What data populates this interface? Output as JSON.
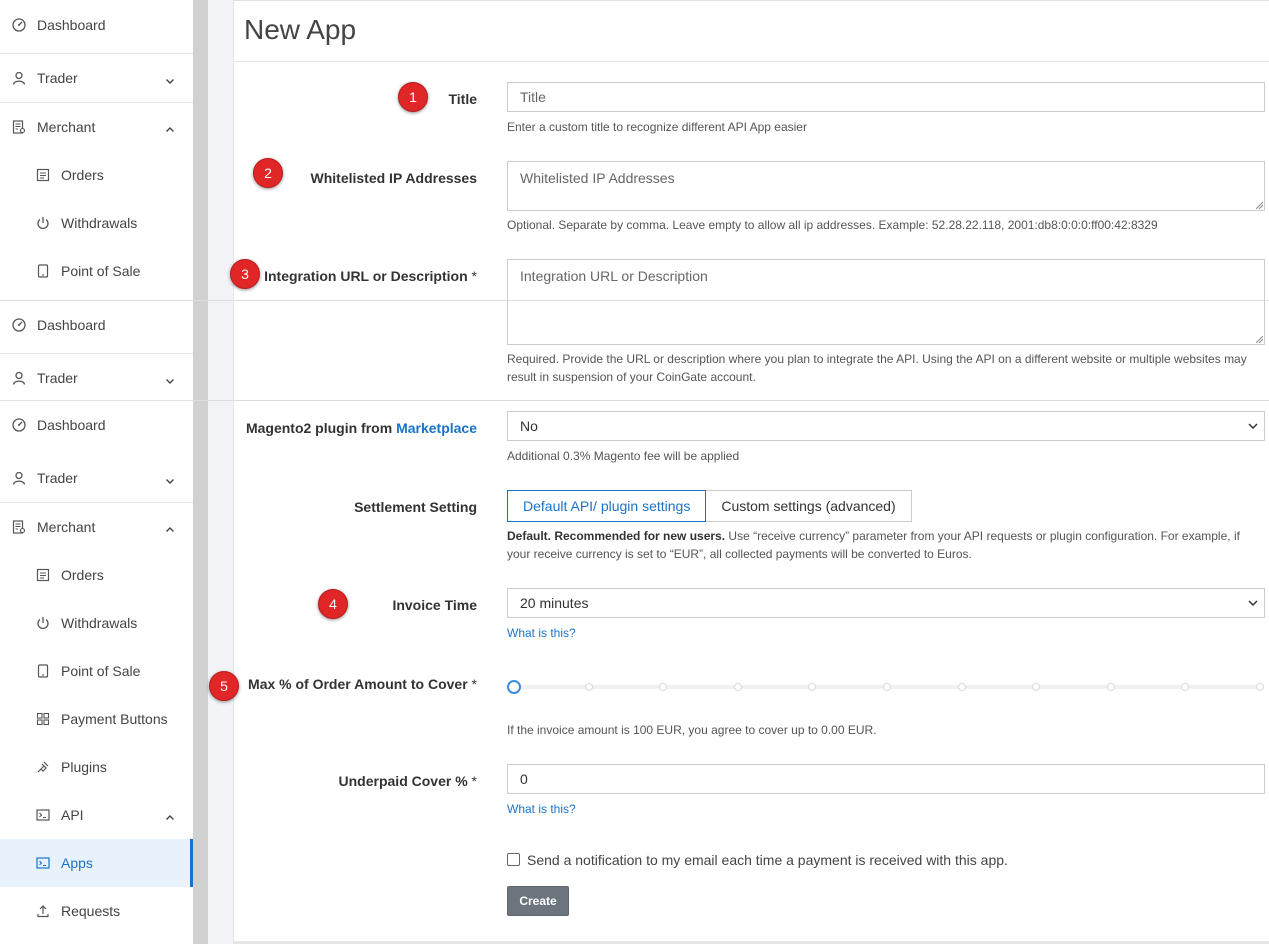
{
  "sidebar": {
    "items": [
      {
        "label": "Dashboard",
        "icon": "dashboard-icon"
      },
      {
        "label": "Trader",
        "icon": "user-icon",
        "chevron": "down"
      },
      {
        "label": "Merchant",
        "icon": "merchant-icon",
        "chevron": "up"
      },
      {
        "label": "Orders",
        "icon": "orders-icon"
      },
      {
        "label": "Withdrawals",
        "icon": "power-icon"
      },
      {
        "label": "Point of Sale",
        "icon": "tablet-icon"
      },
      {
        "label": "Dashboard",
        "icon": "dashboard-icon"
      },
      {
        "label": "Trader",
        "icon": "user-icon",
        "chevron": "down"
      },
      {
        "label": "Dashboard",
        "icon": "dashboard-icon"
      },
      {
        "label": "Trader",
        "icon": "user-icon",
        "chevron": "down"
      },
      {
        "label": "Merchant",
        "icon": "merchant-icon",
        "chevron": "up"
      },
      {
        "label": "Orders",
        "icon": "orders-icon"
      },
      {
        "label": "Withdrawals",
        "icon": "power-icon"
      },
      {
        "label": "Point of Sale",
        "icon": "tablet-icon"
      },
      {
        "label": "Payment Buttons",
        "icon": "grid-icon"
      },
      {
        "label": "Plugins",
        "icon": "plug-icon"
      },
      {
        "label": "API",
        "icon": "terminal-icon",
        "chevron": "up"
      },
      {
        "label": "Apps",
        "icon": "terminal-icon",
        "active": true
      },
      {
        "label": "Requests",
        "icon": "upload-icon"
      }
    ]
  },
  "page": {
    "title": "New App"
  },
  "form": {
    "title_label": "Title",
    "title_placeholder": "Title",
    "title_help": "Enter a custom title to recognize different API App easier",
    "ip_label": "Whitelisted IP Addresses",
    "ip_placeholder": "Whitelisted IP Addresses",
    "ip_help": "Optional. Separate by comma. Leave empty to allow all ip addresses. Example: 52.28.22.118, 2001:db8:0:0:0:ff00:42:8329",
    "url_label": "Integration URL or Description",
    "required_mark": "*",
    "url_placeholder": "Integration URL or Description",
    "url_help": "Required. Provide the URL or description where you plan to integrate the API. Using the API on a different website or multiple websites may result in suspension of your CoinGate account.",
    "magento_label": "Magento2 plugin from",
    "magento_link": "Marketplace",
    "magento_value": "No",
    "magento_help": "Additional 0.3% Magento fee will be applied",
    "settlement_label": "Settlement Setting",
    "settlement_options": [
      "Default API/ plugin settings",
      "Custom settings (advanced)"
    ],
    "settlement_help_bold": "Default. Recommended for new users.",
    "settlement_help": " Use “receive currency” parameter from your API requests or plugin configuration. For example, if your receive currency is set to “EUR”, all collected payments will be converted to Euros.",
    "invoice_label": "Invoice Time",
    "invoice_value": "20 minutes",
    "what_is_this": "What is this?",
    "maxcover_label": "Max % of Order Amount to Cover",
    "maxcover_value_fraction": 0,
    "maxcover_help": "If the invoice amount is 100 EUR, you agree to cover up to 0.00 EUR.",
    "underpaid_label": "Underpaid Cover %",
    "underpaid_value": "0",
    "notify_label": "Send a notification to my email each time a payment is received with this app.",
    "notify_checked": false,
    "create_label": "Create"
  },
  "annotations": [
    "1",
    "2",
    "3",
    "4",
    "5"
  ],
  "colors": {
    "accent": "#1a73c9",
    "badge": "#e02626",
    "button": "#6c757d"
  }
}
